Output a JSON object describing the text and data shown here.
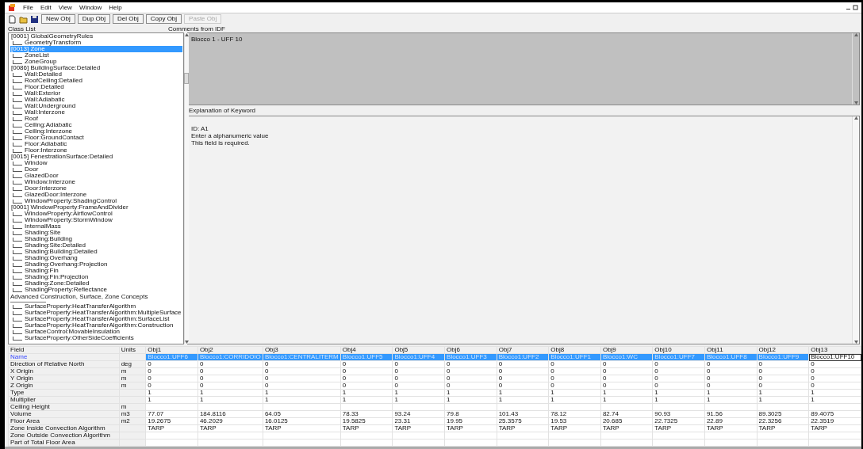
{
  "menu": [
    "File",
    "Edit",
    "View",
    "Window",
    "Help"
  ],
  "toolbar": {
    "buttons": [
      {
        "label": "New Obj",
        "disabled": false
      },
      {
        "label": "Dup Obj",
        "disabled": false
      },
      {
        "label": "Del Obj",
        "disabled": false
      },
      {
        "label": "Copy Obj",
        "disabled": false
      },
      {
        "label": "Paste Obj",
        "disabled": true
      }
    ]
  },
  "class_list": {
    "title": "Class List",
    "items": [
      {
        "kind": "group",
        "label": "[0001]  GlobalGeometryRules",
        "selected": false
      },
      {
        "kind": "item",
        "label": "GeometryTransform",
        "selected": false
      },
      {
        "kind": "group",
        "label": "[0013]  Zone",
        "selected": true
      },
      {
        "kind": "item",
        "label": "ZoneList",
        "selected": false
      },
      {
        "kind": "item",
        "label": "ZoneGroup",
        "selected": false
      },
      {
        "kind": "group",
        "label": "[0086]  BuildingSurface:Detailed",
        "selected": false
      },
      {
        "kind": "item",
        "label": "Wall:Detailed",
        "selected": false
      },
      {
        "kind": "item",
        "label": "RoofCeiling:Detailed",
        "selected": false
      },
      {
        "kind": "item",
        "label": "Floor:Detailed",
        "selected": false
      },
      {
        "kind": "item",
        "label": "Wall:Exterior",
        "selected": false
      },
      {
        "kind": "item",
        "label": "Wall:Adiabatic",
        "selected": false
      },
      {
        "kind": "item",
        "label": "Wall:Underground",
        "selected": false
      },
      {
        "kind": "item",
        "label": "Wall:Interzone",
        "selected": false
      },
      {
        "kind": "item",
        "label": "Roof",
        "selected": false
      },
      {
        "kind": "item",
        "label": "Ceiling:Adiabatic",
        "selected": false
      },
      {
        "kind": "item",
        "label": "Ceiling:Interzone",
        "selected": false
      },
      {
        "kind": "item",
        "label": "Floor:GroundContact",
        "selected": false
      },
      {
        "kind": "item",
        "label": "Floor:Adiabatic",
        "selected": false
      },
      {
        "kind": "item",
        "label": "Floor:Interzone",
        "selected": false
      },
      {
        "kind": "group",
        "label": "[0015]  FenestrationSurface:Detailed",
        "selected": false
      },
      {
        "kind": "item",
        "label": "Window",
        "selected": false
      },
      {
        "kind": "item",
        "label": "Door",
        "selected": false
      },
      {
        "kind": "item",
        "label": "GlazedDoor",
        "selected": false
      },
      {
        "kind": "item",
        "label": "Window:Interzone",
        "selected": false
      },
      {
        "kind": "item",
        "label": "Door:Interzone",
        "selected": false
      },
      {
        "kind": "item",
        "label": "GlazedDoor:Interzone",
        "selected": false
      },
      {
        "kind": "item",
        "label": "WindowProperty:ShadingControl",
        "selected": false
      },
      {
        "kind": "group",
        "label": "[0001]  WindowProperty:FrameAndDivider",
        "selected": false
      },
      {
        "kind": "item",
        "label": "WindowProperty:AirflowControl",
        "selected": false
      },
      {
        "kind": "item",
        "label": "WindowProperty:StormWindow",
        "selected": false
      },
      {
        "kind": "item",
        "label": "InternalMass",
        "selected": false
      },
      {
        "kind": "item",
        "label": "Shading:Site",
        "selected": false
      },
      {
        "kind": "item",
        "label": "Shading:Building",
        "selected": false
      },
      {
        "kind": "item",
        "label": "Shading:Site:Detailed",
        "selected": false
      },
      {
        "kind": "item",
        "label": "Shading:Building:Detailed",
        "selected": false
      },
      {
        "kind": "item",
        "label": "Shading:Overhang",
        "selected": false
      },
      {
        "kind": "item",
        "label": "Shading:Overhang:Projection",
        "selected": false
      },
      {
        "kind": "item",
        "label": "Shading:Fin",
        "selected": false
      },
      {
        "kind": "item",
        "label": "Shading:Fin:Projection",
        "selected": false
      },
      {
        "kind": "item",
        "label": "Shading:Zone:Detailed",
        "selected": false
      },
      {
        "kind": "item",
        "label": "ShadingProperty:Reflectance",
        "selected": false
      },
      {
        "kind": "section",
        "label": "Advanced Construction, Surface, Zone Concepts",
        "selected": false
      },
      {
        "kind": "item",
        "label": "SurfaceProperty:HeatTransferAlgorithm",
        "selected": false
      },
      {
        "kind": "item",
        "label": "SurfaceProperty:HeatTransferAlgorithm:MultipleSurface",
        "selected": false
      },
      {
        "kind": "item",
        "label": "SurfaceProperty:HeatTransferAlgorithm:SurfaceList",
        "selected": false
      },
      {
        "kind": "item",
        "label": "SurfaceProperty:HeatTransferAlgorithm:Construction",
        "selected": false
      },
      {
        "kind": "item",
        "label": "SurfaceControl:MovableInsulation",
        "selected": false
      },
      {
        "kind": "item",
        "label": "SurfaceProperty:OtherSideCoefficients",
        "selected": false
      }
    ]
  },
  "comments": {
    "title": "Comments from IDF",
    "text": "Blocco 1 - UFF 10"
  },
  "explanation": {
    "title": "Explanation of Keyword",
    "lines": [
      "ID: A1",
      "Enter a alphanumeric value",
      "This field is required."
    ]
  },
  "grid": {
    "field_header": "Field",
    "units_header": "Units",
    "columns": [
      {
        "header": "Obj1",
        "selected": true
      },
      {
        "header": "Obj2",
        "selected": true
      },
      {
        "header": "Obj3",
        "selected": true
      },
      {
        "header": "Obj4",
        "selected": true
      },
      {
        "header": "Obj5",
        "selected": true
      },
      {
        "header": "Obj6",
        "selected": true
      },
      {
        "header": "Obj7",
        "selected": true
      },
      {
        "header": "Obj8",
        "selected": true
      },
      {
        "header": "Obj9",
        "selected": true
      },
      {
        "header": "Obj10",
        "selected": true
      },
      {
        "header": "Obj11",
        "selected": true
      },
      {
        "header": "Obj12",
        "selected": true
      },
      {
        "header": "Obj13",
        "selected": false
      }
    ],
    "rows": [
      {
        "kind": "name",
        "field": "Name",
        "values": [
          "Blocco1:UFF6",
          "Blocco1:CORRIDOIO",
          "Blocco1:CENTRALITERM",
          "Blocco1:UFF5",
          "Blocco1:UFF4",
          "Blocco1:UFF3",
          "Blocco1:UFF2",
          "Blocco1:UFF1",
          "Blocco1:WC",
          "Blocco1:UFF7",
          "Blocco1:UFF8",
          "Blocco1:UFF9",
          "Blocco1:UFF10"
        ]
      },
      {
        "kind": "value",
        "field": "Direction of Relative North",
        "units": "deg",
        "values": [
          "0",
          "0",
          "0",
          "0",
          "0",
          "0",
          "0",
          "0",
          "0",
          "0",
          "0",
          "0",
          "0"
        ]
      },
      {
        "kind": "value",
        "field": "X Origin",
        "units": "m",
        "values": [
          "0",
          "0",
          "0",
          "0",
          "0",
          "0",
          "0",
          "0",
          "0",
          "0",
          "0",
          "0",
          "0"
        ]
      },
      {
        "kind": "value",
        "field": "Y Origin",
        "units": "m",
        "values": [
          "0",
          "0",
          "0",
          "0",
          "0",
          "0",
          "0",
          "0",
          "0",
          "0",
          "0",
          "0",
          "0"
        ]
      },
      {
        "kind": "value",
        "field": "Z Origin",
        "units": "m",
        "values": [
          "0",
          "0",
          "0",
          "0",
          "0",
          "0",
          "0",
          "0",
          "0",
          "0",
          "0",
          "0",
          "0"
        ]
      },
      {
        "kind": "value",
        "field": "Type",
        "values": [
          "1",
          "1",
          "1",
          "1",
          "1",
          "1",
          "1",
          "1",
          "1",
          "1",
          "1",
          "1",
          "1"
        ]
      },
      {
        "kind": "value",
        "field": "Multiplier",
        "values": [
          "1",
          "1",
          "1",
          "1",
          "1",
          "1",
          "1",
          "1",
          "1",
          "1",
          "1",
          "1",
          "1"
        ]
      },
      {
        "kind": "value",
        "field": "Ceiling Height",
        "units": "m"
      },
      {
        "kind": "value",
        "field": "Volume",
        "units": "m3",
        "values": [
          "77.07",
          "184.8116",
          "64.05",
          "78.33",
          "93.24",
          "79.8",
          "101.43",
          "78.12",
          "82.74",
          "90.93",
          "91.56",
          "89.3025",
          "89.4075"
        ]
      },
      {
        "kind": "value",
        "field": "Floor Area",
        "units": "m2",
        "values": [
          "19.2675",
          "46.2029",
          "16.0125",
          "19.5825",
          "23.31",
          "19.95",
          "25.3575",
          "19.53",
          "20.685",
          "22.7325",
          "22.89",
          "22.3256",
          "22.3519"
        ]
      },
      {
        "kind": "value",
        "field": "Zone Inside Convection Algorithm",
        "values": [
          "TARP",
          "TARP",
          "TARP",
          "TARP",
          "TARP",
          "TARP",
          "TARP",
          "TARP",
          "TARP",
          "TARP",
          "TARP",
          "TARP",
          "TARP"
        ]
      },
      {
        "kind": "value",
        "field": "Zone Outside Convection Algorithm"
      },
      {
        "kind": "value",
        "field": "Part of Total Floor Area"
      }
    ]
  }
}
